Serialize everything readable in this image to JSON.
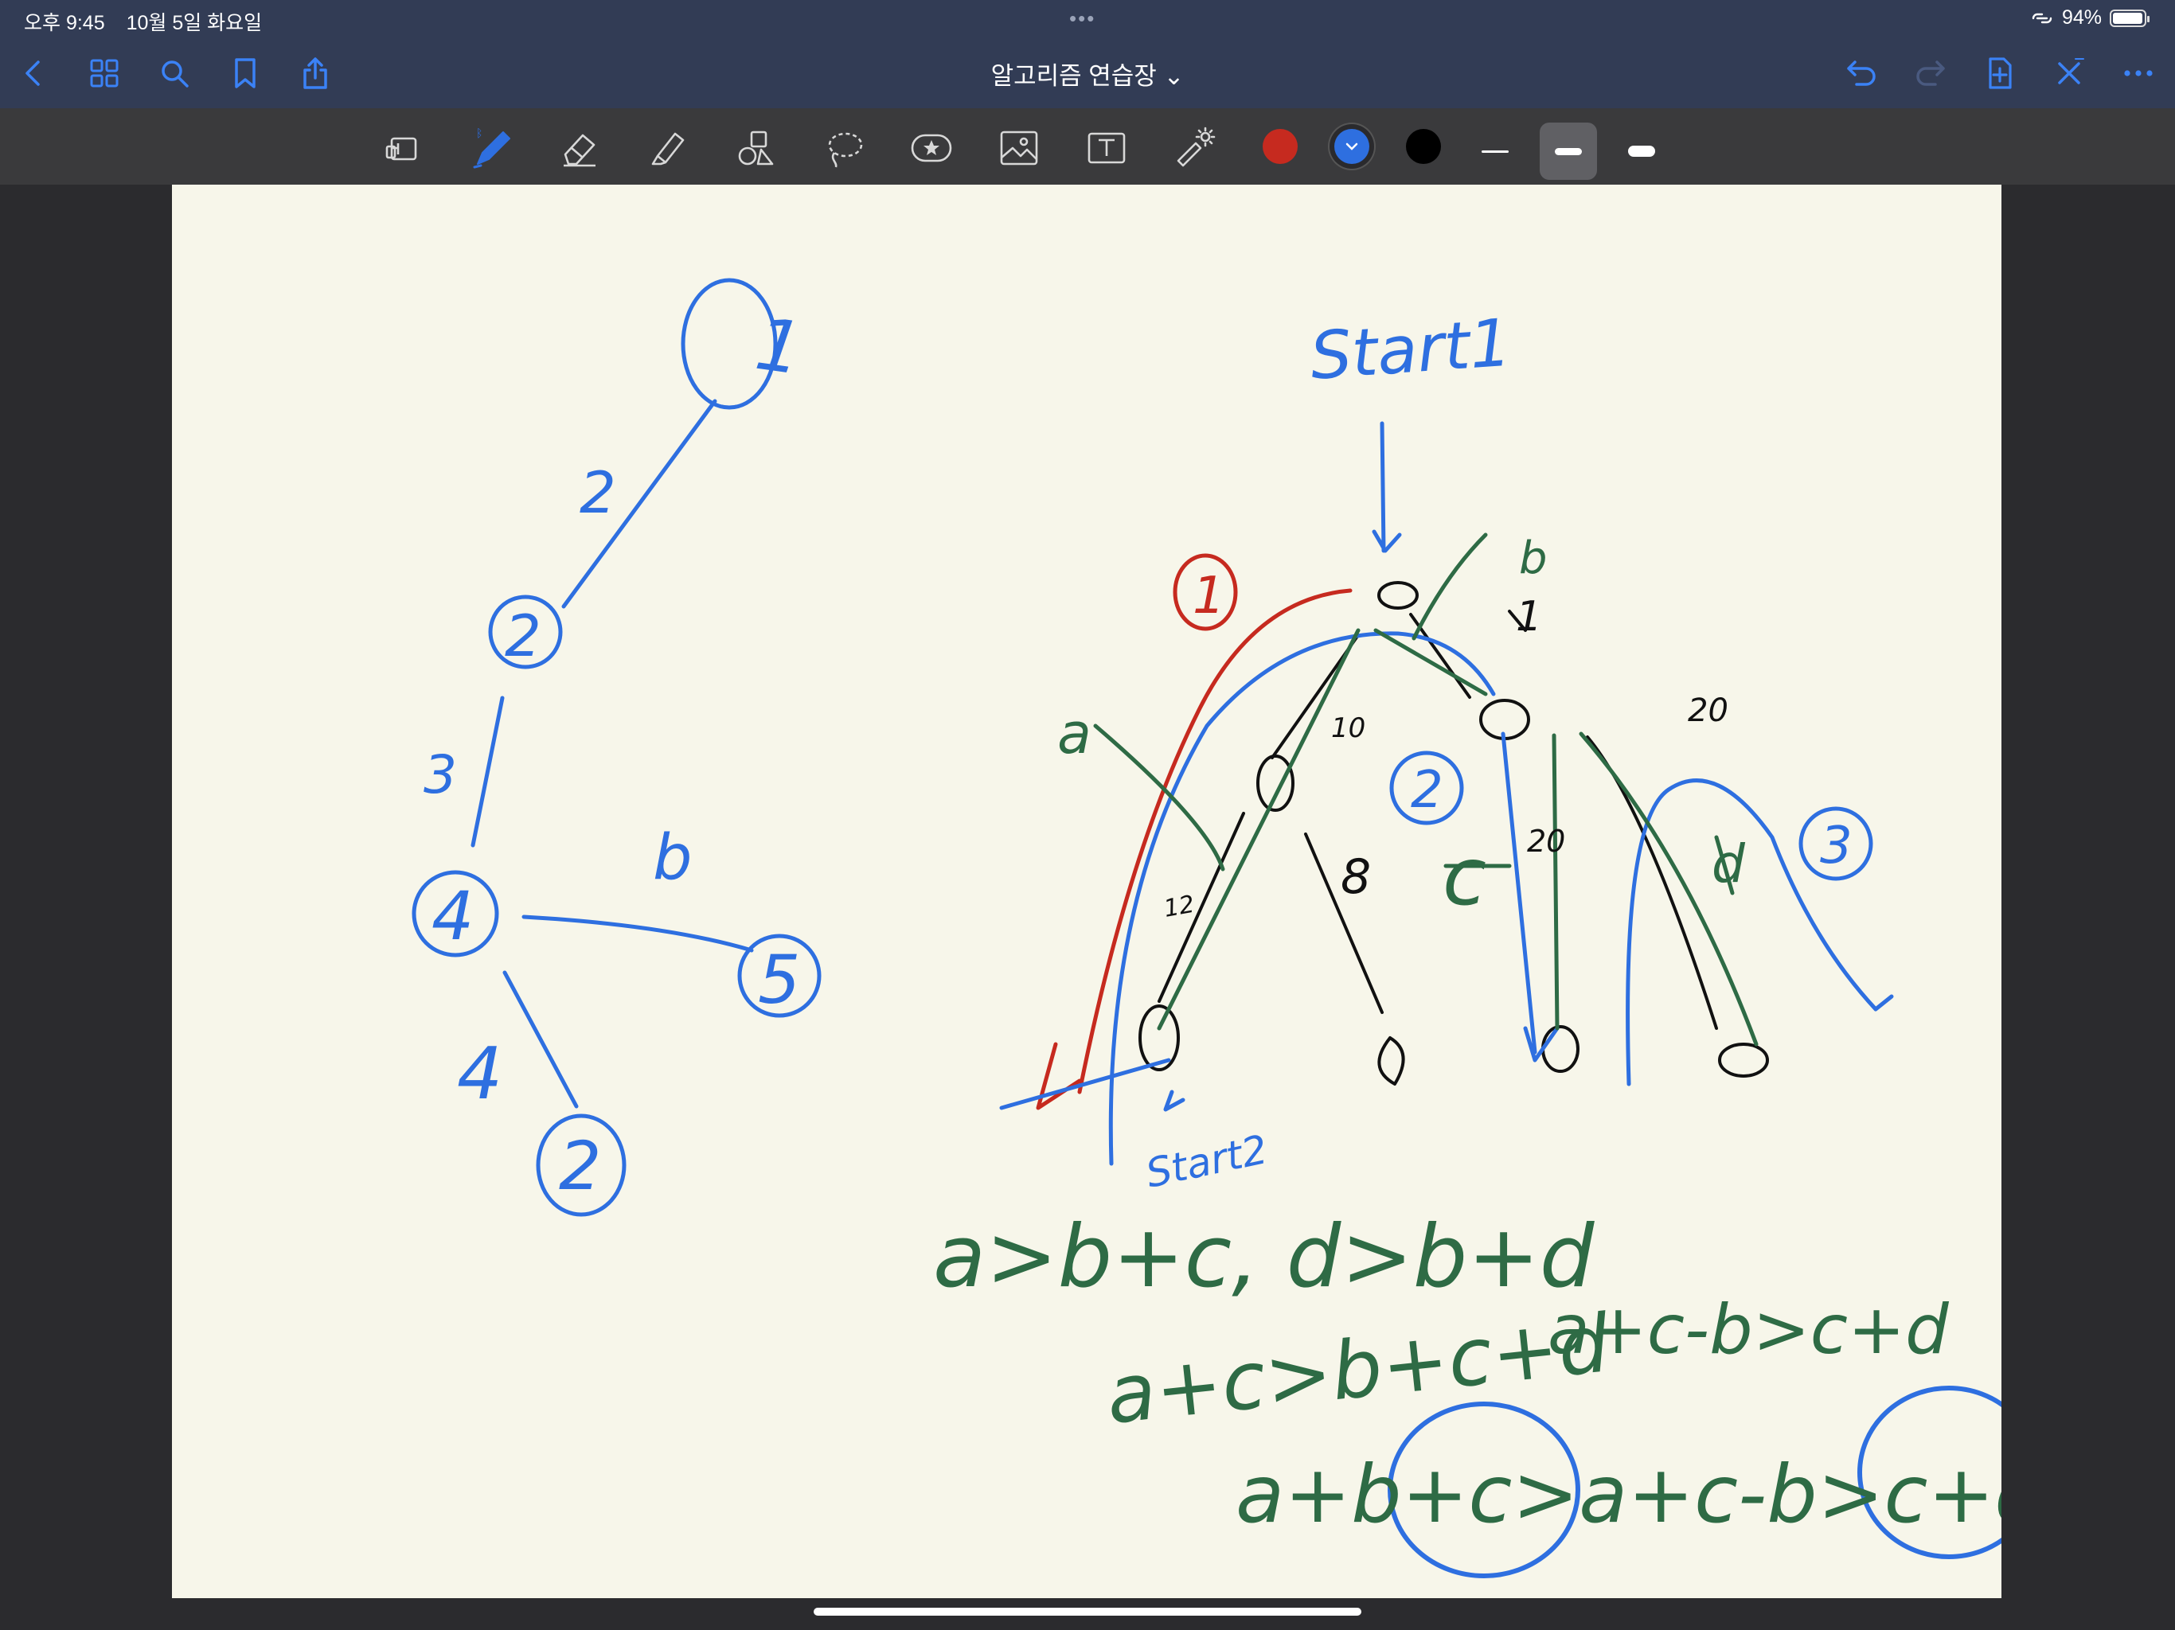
{
  "status_bar": {
    "time": "오후 9:45",
    "date": "10월 5일 화요일",
    "battery": "94%",
    "battery_level": 0.94
  },
  "nav_bar": {
    "title": "알고리즘 연습장 ⌄",
    "icons_left": [
      "back-icon",
      "thumbnails-grid-icon",
      "search-icon",
      "bookmark-icon",
      "share-icon"
    ],
    "icons_right": [
      "undo-icon",
      "redo-icon",
      "add-page-icon",
      "close-pen-icon",
      "more-icon"
    ]
  },
  "toolbar": {
    "tools": [
      "read-only-icon",
      "pen-icon",
      "eraser-icon",
      "highlighter-icon",
      "shapes-icon",
      "lasso-icon",
      "elements-icon",
      "image-icon",
      "text-icon",
      "laser-pointer-icon"
    ],
    "selected_tool": "pen-icon",
    "colors": [
      "#c62a1f",
      "#2e6fe0",
      "#000000"
    ],
    "selected_color": "#2e6fe0",
    "stroke_widths": [
      "thin",
      "medium",
      "thick"
    ],
    "selected_stroke": "medium"
  },
  "canvas": {
    "background": "#f7f6ea",
    "ink_colors": {
      "blue": "#2e6fe0",
      "green": "#2e6b45",
      "red": "#c62a1f",
      "black": "#111111"
    },
    "handwriting": {
      "start1": "Start1",
      "start2": "Start2",
      "node1": "1",
      "node2": "2",
      "node3": "3",
      "node4": "4",
      "node5": "5",
      "edge_2": "2",
      "edge_3": "3",
      "edge_4": "4",
      "edge_b": "b",
      "edge_10": "10",
      "edge_12": "12",
      "edge_8": "8",
      "edge_20a": "20",
      "edge_20b": "20",
      "edge_1": "1",
      "label_a": "a",
      "label_b": "b",
      "label_c": "c",
      "label_d": "d",
      "circle_1": "1",
      "circle_2": "2",
      "circle_3": "3",
      "eq1": "a>b+c, d>b+d",
      "eq2": "a+c>b+c+d",
      "eq3": "a+c-b>c+d",
      "eq4": "a+b+c>a+c-b>c+d"
    }
  }
}
